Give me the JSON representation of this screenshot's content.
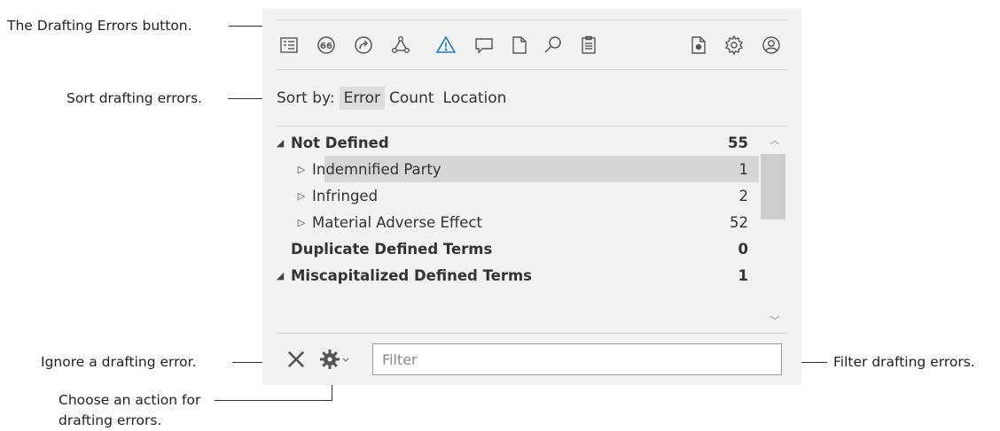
{
  "callouts": {
    "drafting_errors_button": "The Drafting Errors button.",
    "sort": "Sort drafting errors.",
    "ignore": "Ignore a drafting error.",
    "action_line1": "Choose an action for",
    "action_line2": "drafting errors.",
    "filter": "Filter drafting errors."
  },
  "toolbar": {
    "icons": [
      "definitions-icon",
      "quote-icon",
      "share-arrow-icon",
      "network-icon",
      "warning-icon",
      "comment-icon",
      "document-icon",
      "search-icon",
      "clipboard-icon",
      "document-gear-icon",
      "settings-icon",
      "account-icon"
    ],
    "active": "warning-icon",
    "accent_color": "#1a7bd0"
  },
  "sort": {
    "label": "Sort by:",
    "options": [
      "Error",
      "Count",
      "Location"
    ],
    "selected": "Error"
  },
  "errors": [
    {
      "label": "Not Defined",
      "count": "55",
      "bold": true,
      "expanded": true,
      "level": 0
    },
    {
      "label": "Indemnified Party",
      "count": "1",
      "bold": false,
      "level": 1,
      "selected": true
    },
    {
      "label": "Infringed",
      "count": "2",
      "bold": false,
      "level": 1
    },
    {
      "label": "Material Adverse Effect",
      "count": "52",
      "bold": false,
      "level": 1
    },
    {
      "label": "Duplicate Defined Terms",
      "count": "0",
      "bold": true,
      "level": 0
    },
    {
      "label": "Miscapitalized Defined Terms",
      "count": "1",
      "bold": true,
      "expanded": true,
      "level": 0
    }
  ],
  "filter": {
    "placeholder": "Filter",
    "value": ""
  }
}
